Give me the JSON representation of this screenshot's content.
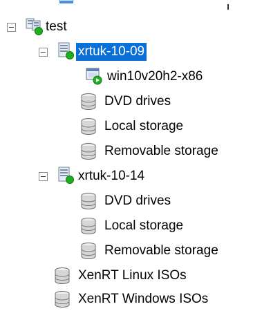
{
  "tree": {
    "root": {
      "label": "test",
      "expanded": true,
      "icon": "pool-icon",
      "hosts": [
        {
          "label": "xrtuk-10-09",
          "selected": true,
          "expanded": true,
          "icon": "host-icon",
          "children": [
            {
              "label": "win10v20h2-x86",
              "icon": "vm-running-icon"
            },
            {
              "label": "DVD drives",
              "icon": "storage-icon"
            },
            {
              "label": "Local storage",
              "icon": "storage-icon"
            },
            {
              "label": "Removable storage",
              "icon": "storage-icon"
            }
          ]
        },
        {
          "label": "xrtuk-10-14",
          "selected": false,
          "expanded": true,
          "icon": "host-icon",
          "children": [
            {
              "label": "DVD drives",
              "icon": "storage-icon"
            },
            {
              "label": "Local storage",
              "icon": "storage-icon"
            },
            {
              "label": "Removable storage",
              "icon": "storage-icon"
            }
          ]
        }
      ],
      "pool_storage": [
        {
          "label": "XenRT Linux ISOs",
          "icon": "storage-icon"
        },
        {
          "label": "XenRT Windows ISOs",
          "icon": "storage-icon"
        }
      ]
    }
  },
  "colors": {
    "selection": "#0a6fd6",
    "status_green": "#1fae1f"
  }
}
